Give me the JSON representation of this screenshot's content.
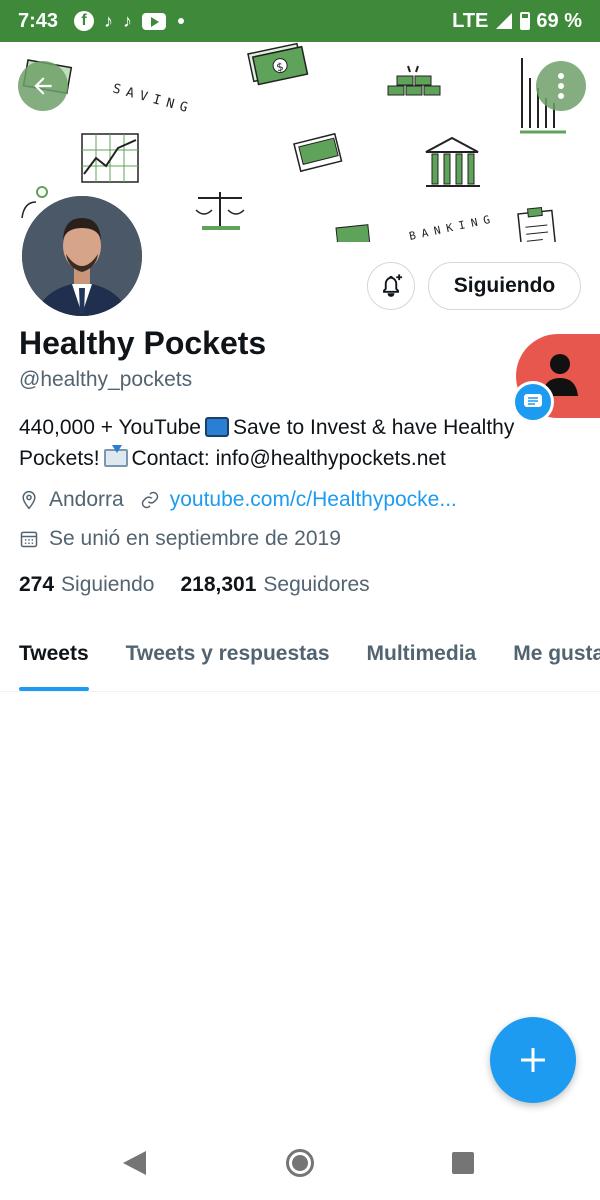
{
  "status_bar": {
    "time": "7:43",
    "network": "LTE",
    "battery": "69 %",
    "battery_level": 0.69,
    "notification_icons": [
      "facebook-icon",
      "tiktok-icon",
      "tiktok-icon",
      "youtube-icon"
    ]
  },
  "banner": {
    "saving_text": "SAVING",
    "banking_text": "BANKING",
    "accent_color": "#3f8a3a"
  },
  "profile": {
    "display_name": "Healthy Pockets",
    "handle": "@healthy_pockets",
    "bio_part1": "440,000 + YouTube",
    "bio_part2": "Save to Invest & have Healthy Pockets!",
    "bio_part3": "Contact: info@healthypockets.net",
    "location": "Andorra",
    "website": "youtube.com/c/Healthypocke...",
    "joined": "Se unió en septiembre de 2019",
    "following_count": "274",
    "following_label": "Siguiendo",
    "followers_count": "218,301",
    "followers_label": "Seguidores"
  },
  "actions": {
    "following_button": "Siguiendo"
  },
  "tabs": [
    {
      "label": "Tweets",
      "active": true
    },
    {
      "label": "Tweets y respuestas",
      "active": false
    },
    {
      "label": "Multimedia",
      "active": false
    },
    {
      "label": "Me gusta",
      "active": false
    }
  ],
  "colors": {
    "accent": "#1d9bf0",
    "status_bar": "#3f8a3a",
    "chat_head": "#e8574d"
  }
}
